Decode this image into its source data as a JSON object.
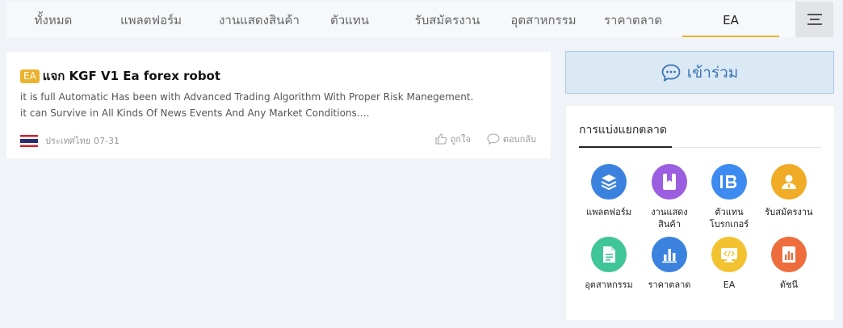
{
  "tabs": [
    {
      "label": "ทั้งหมด"
    },
    {
      "label": "แพลตฟอร์ม"
    },
    {
      "label": "งานแสดงสินค้า"
    },
    {
      "label": "ตัวแทน"
    },
    {
      "label": "รับสมัครงาน"
    },
    {
      "label": "อุตสาหกรรม"
    },
    {
      "label": "ราคาตลาด"
    },
    {
      "label": "EA"
    }
  ],
  "active_tab": "EA",
  "post": {
    "badge": "EA",
    "title": "แจก KGF V1 Ea forex robot",
    "body_line1": "it is full Automatic Has been with Advanced Trading Algorithm With Proper Risk Manegement.",
    "body_line2": "it can Survive in All Kinds Of News Events And Any Market Conditions.…",
    "country": "ประเทศไทย",
    "date": "07-31",
    "like_label": "ถูกใจ",
    "reply_label": "ตอบกลับ"
  },
  "join": {
    "label": "เข้าร่วม"
  },
  "categories": {
    "header": "การแบ่งแยกตลาด",
    "items": [
      {
        "line1": "แพลตฟอร์ม",
        "line2": "",
        "icon": "layers-icon",
        "color": "#3b82de"
      },
      {
        "line1": "งานแสดง",
        "line2": "สินค้า",
        "icon": "bookmark-icon",
        "color": "#9b5ee0"
      },
      {
        "line1": "ตัวแทน",
        "line2": "โบรกเกอร์",
        "icon": "ib-icon",
        "color": "#3d8bf0"
      },
      {
        "line1": "รับสมัครงาน",
        "line2": "",
        "icon": "person-icon",
        "color": "#f0ac27"
      },
      {
        "line1": "อุตสาหกรรม",
        "line2": "",
        "icon": "document-icon",
        "color": "#3fc597"
      },
      {
        "line1": "ราคาตลาด",
        "line2": "",
        "icon": "bar-chart-icon",
        "color": "#3b82de"
      },
      {
        "line1": "EA",
        "line2": "",
        "icon": "code-icon",
        "color": "#f3c230"
      },
      {
        "line1": "ดัชนี",
        "line2": "",
        "icon": "index-icon",
        "color": "#ee6d3d"
      }
    ]
  },
  "colors": {
    "accent": "#e8b52b",
    "join_text": "#3b74b3"
  }
}
